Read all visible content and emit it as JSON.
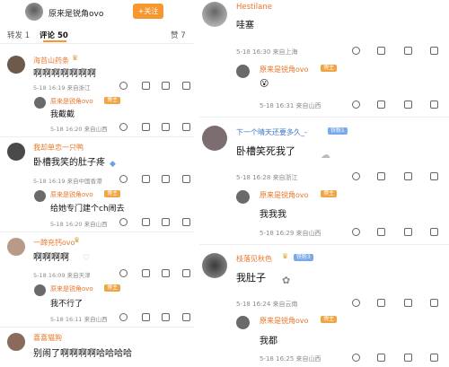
{
  "header": {
    "account": "原来是锐角ovo",
    "follow_label": "+关注",
    "tab_repost": "转发 1",
    "tab_comment": "评论 50",
    "tab_like": "赞 7"
  },
  "left_comments": [
    {
      "user": "海苔山药条",
      "text": "啊啊啊啊啊啊啊",
      "meta": "5-18 16:19 来自浙江",
      "reply": {
        "user": "原来是锐角ovo",
        "badge": "博主",
        "text": "我截截",
        "meta": "5-18 16:20 来自山西"
      }
    },
    {
      "user": "我却单恋一只鸭",
      "text": "卧槽我笑的肚子疼",
      "meta": "5-18 16:19 来自中国香港",
      "reply": {
        "user": "原来是锐角ovo",
        "badge": "博主",
        "text": "给她专门建个ch闹去",
        "meta": "5-18 16:20 来自山西"
      }
    },
    {
      "user": "一蹄充钙ovo",
      "text": "啊啊啊啊",
      "meta": "5-18 16:09 来自天津",
      "reply": {
        "user": "原来是锐角ovo",
        "badge": "博主",
        "text": "我不行了",
        "meta": "5-18 16:11 来自山西"
      }
    },
    {
      "user": "喜喜猫狗",
      "text": "别闹了啊啊啊啊哈哈哈哈",
      "meta": ""
    }
  ],
  "right_comments": [
    {
      "user": "Hestilane",
      "text": "哇塞",
      "meta": "5-18 16:30 来自上海",
      "reply": {
        "user": "原来是锐角ovo",
        "badge": "博主",
        "text": "😮",
        "meta": "5-18 16:31 来自山西"
      }
    },
    {
      "user": "下一个晴天还要多久_-",
      "level": "铁粉1",
      "text": "卧槽笑死我了",
      "meta": "5-18 16:28 来自浙江",
      "reply": {
        "user": "原来是锐角ovo",
        "badge": "博主",
        "text": "我我我",
        "meta": "5-18 16:29 来自山西"
      }
    },
    {
      "user": "枝落见秋色",
      "level": "铁粉3",
      "text": "我肚子",
      "meta": "5-18 16:24 来自云南",
      "reply": {
        "user": "原来是锐角ovo",
        "badge": "博主",
        "text": "我都",
        "meta": "5-18 16:25 来自山西"
      }
    }
  ],
  "colors": {
    "accent": "#f7972f",
    "name": "#e8762a",
    "blue_name": "#3a78c8"
  }
}
